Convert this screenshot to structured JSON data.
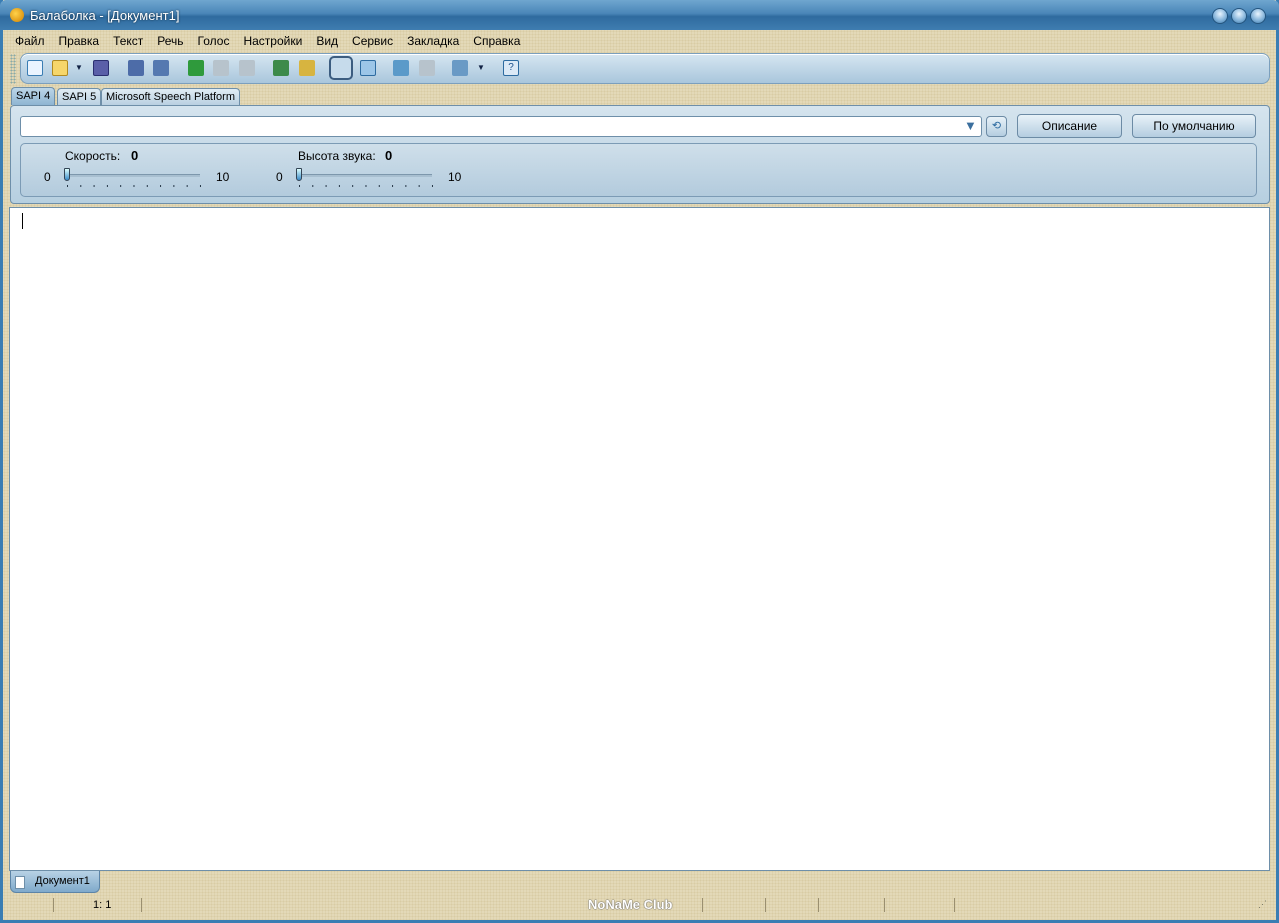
{
  "window": {
    "title": "Балаболка - [Документ1]"
  },
  "menu": [
    "Файл",
    "Правка",
    "Текст",
    "Речь",
    "Голос",
    "Настройки",
    "Вид",
    "Сервис",
    "Закладка",
    "Справка"
  ],
  "toolbar": {
    "icons": [
      "new-icon",
      "open-icon",
      "save-icon",
      "save-audio-icon",
      "save-audio-split-icon",
      "play-icon",
      "pause-icon",
      "stop-icon",
      "read-clipboard-icon",
      "read-file-icon",
      "edit-mode-icon",
      "text-compare-icon",
      "add-bookmark-icon",
      "remove-bookmark-icon",
      "dictionary-icon",
      "help-icon"
    ],
    "colors": {
      "accent": "#3a7db3"
    }
  },
  "engine_tabs": [
    "SAPI 4",
    "SAPI 5",
    "Microsoft Speech Platform"
  ],
  "voice": {
    "selected": "",
    "description_button": "Описание",
    "default_button": "По умолчанию",
    "speed": {
      "label": "Скорость:",
      "value": "0",
      "min": "0",
      "max": "10"
    },
    "pitch": {
      "label": "Высота звука:",
      "value": "0",
      "min": "0",
      "max": "10"
    }
  },
  "editor": {
    "text": ""
  },
  "documents": [
    "Документ1"
  ],
  "status": {
    "position": "1:  1",
    "watermark": "NoNaMe Club"
  }
}
